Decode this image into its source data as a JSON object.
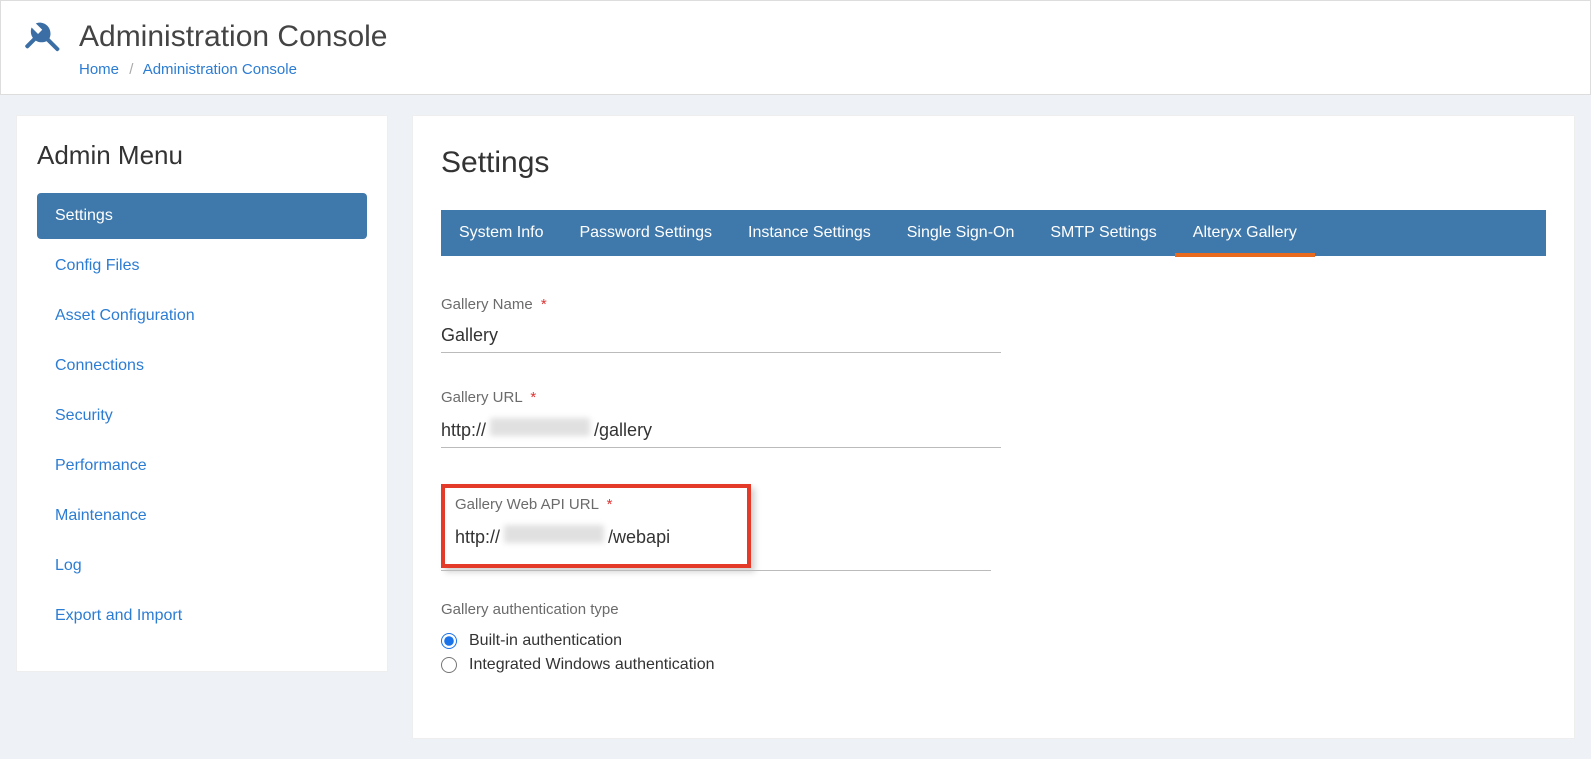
{
  "header": {
    "title": "Administration Console",
    "breadcrumb": {
      "home": "Home",
      "current": "Administration Console"
    }
  },
  "sidebar": {
    "title": "Admin Menu",
    "items": [
      {
        "label": "Settings",
        "active": true
      },
      {
        "label": "Config Files",
        "active": false
      },
      {
        "label": "Asset Configuration",
        "active": false
      },
      {
        "label": "Connections",
        "active": false
      },
      {
        "label": "Security",
        "active": false
      },
      {
        "label": "Performance",
        "active": false
      },
      {
        "label": "Maintenance",
        "active": false
      },
      {
        "label": "Log",
        "active": false
      },
      {
        "label": "Export and Import",
        "active": false
      }
    ]
  },
  "main": {
    "title": "Settings",
    "tabs": [
      {
        "label": "System Info",
        "active": false
      },
      {
        "label": "Password Settings",
        "active": false
      },
      {
        "label": "Instance Settings",
        "active": false
      },
      {
        "label": "Single Sign-On",
        "active": false
      },
      {
        "label": "SMTP Settings",
        "active": false
      },
      {
        "label": "Alteryx Gallery",
        "active": true
      }
    ],
    "fields": {
      "gallery_name": {
        "label": "Gallery Name",
        "required": true,
        "value": "Gallery"
      },
      "gallery_url": {
        "label": "Gallery URL",
        "required": true,
        "prefix": "http://",
        "suffix": "/gallery",
        "redacted": true
      },
      "gallery_api": {
        "label": "Gallery Web API URL",
        "required": true,
        "prefix": "http://",
        "suffix": "/webapi",
        "redacted": true
      },
      "auth_type": {
        "label": "Gallery authentication type",
        "options": [
          {
            "label": "Built-in authentication",
            "checked": true
          },
          {
            "label": "Integrated Windows authentication",
            "checked": false
          }
        ]
      }
    }
  }
}
